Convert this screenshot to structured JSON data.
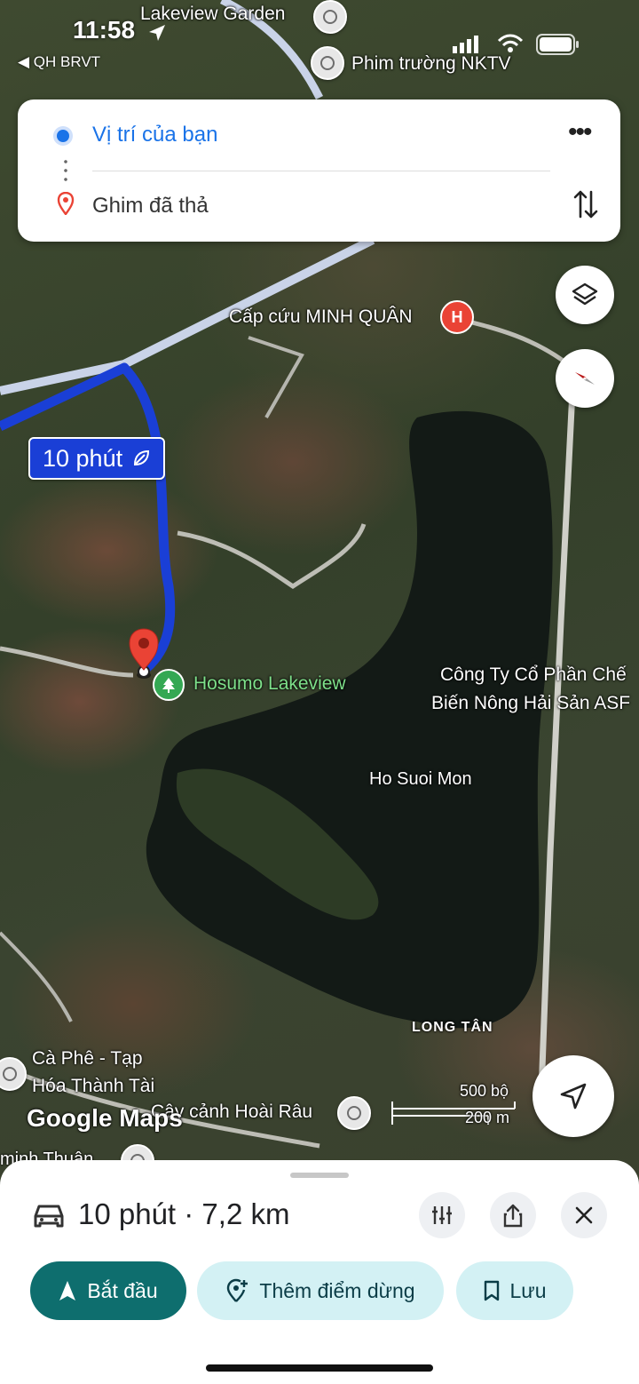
{
  "status_bar": {
    "time": "11:58",
    "back_app": "QH BRVT"
  },
  "route": {
    "from": "Vị trí của bạn",
    "to": "Ghim đã thả",
    "more_icon": "more-vert-icon",
    "swap_icon": "swap-vertical-icon"
  },
  "map": {
    "eta_badge": "10 phút",
    "labels": {
      "lakeview_garden": "Lakeview Garden",
      "phim_truong": "Phim trường NKTV",
      "cap_cuu": "Cấp cứu MINH QUÂN",
      "hosumo": "Hosumo Lakeview",
      "cong_ty_1": "Công Ty Cổ Phần Chế",
      "cong_ty_2": "Biến Nông Hải Sản ASF",
      "ho_suoi_mon": "Ho Suoi Mon",
      "long_tan": "LONG TÂN",
      "ca_phe_1": "Cà Phê - Tạp",
      "ca_phe_2": "Hóa Thành Tài",
      "cay_canh": "Cây cảnh Hoài Râu",
      "minh_thuan": "minh Thuận",
      "google_maps": "Google Maps"
    },
    "scale": {
      "top": "500 bộ",
      "bottom": "200 m"
    },
    "colors": {
      "route": "#1a3fd6",
      "pin": "#ea4335",
      "park": "#34a853",
      "hospital": "#ea4335"
    }
  },
  "sheet": {
    "summary": "10 phút · 7,2 km",
    "start_label": "Bắt đầu",
    "add_stop_label": "Thêm điểm dừng",
    "save_label": "Lưu"
  }
}
